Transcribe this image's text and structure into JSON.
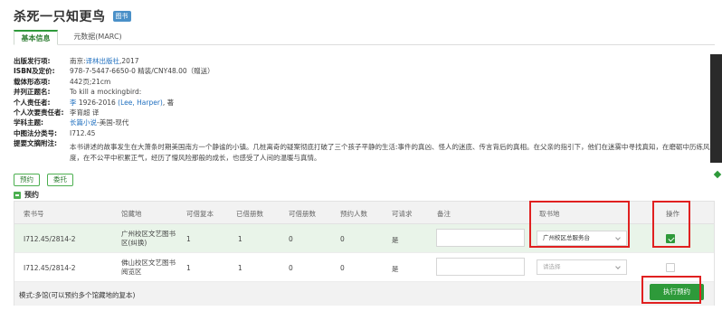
{
  "book": {
    "title": "杀死一只知更鸟",
    "badge": "图书"
  },
  "tabs": [
    {
      "label": "基本信息",
      "active": true
    },
    {
      "label": "元数据(MARC)",
      "active": false
    }
  ],
  "fields": [
    {
      "label": "出版发行项:",
      "pre": "南京:",
      "link": "译林出版社",
      "post": ",2017"
    },
    {
      "label": "ISBN及定价:",
      "pre": "978-7-5447-6650-0 精装/CNY48.00（赠送）",
      "link": "",
      "post": ""
    },
    {
      "label": "载体形态项:",
      "pre": "442页;21cm",
      "link": "",
      "post": ""
    },
    {
      "label": "并列正题名:",
      "pre": "To kill a mockingbird:",
      "link": "",
      "post": ""
    },
    {
      "label": "个人责任者:",
      "pre": "",
      "link": "李",
      "post": " 1926-2016 ",
      "link2": "(Lee, Harper)",
      "post2": ", 著"
    },
    {
      "label": "个人次要责任者:",
      "pre": "李育超 译",
      "link": "",
      "post": ""
    },
    {
      "label": "学科主题:",
      "pre": "",
      "link": "长篇小说",
      "post": "-美国-现代"
    },
    {
      "label": "中图法分类号:",
      "pre": "I712.45",
      "link": "",
      "post": ""
    },
    {
      "label": "提要文摘附注:",
      "pre": "",
      "link": "",
      "post": ""
    }
  ],
  "summary": "本书讲述的故事发生在大萧条时期美国南方一个静谧的小镇。几桩离奇的疑案彻底打破了三个孩子平静的生活:事件的真凶、怪人的迷底、传言背后的真相。在父亲的指引下，他们在迷雾中寻找真知，在磨砺中历练风度，在不公平中积累正气，经历了懵风险那般的成长，也感受了人间的温暖与真情。",
  "buttons": {
    "reserve": "预约",
    "delegate": "委托"
  },
  "reserve_section": {
    "title": "预约"
  },
  "table": {
    "headers": [
      "索书号",
      "馆藏地",
      "可借复本",
      "已借册数",
      "可借册数",
      "预约人数",
      "可请求",
      "备注",
      "取书地",
      "操作"
    ],
    "rows": [
      {
        "call_no": "I712.45/2814-2",
        "location": "广州校区文艺图书区(纠换)",
        "avail_copies": "1",
        "borrowed": "1",
        "loanable": "0",
        "reservations": "0",
        "requestable": "是",
        "remark": "",
        "pickup": "广州校区总服务台",
        "pickup_placeholder": false,
        "checked": true
      },
      {
        "call_no": "I712.45/2814-2",
        "location": "佛山校区文艺图书阅览区",
        "avail_copies": "1",
        "borrowed": "1",
        "loanable": "0",
        "reservations": "0",
        "requestable": "是",
        "remark": "",
        "pickup": "请选择",
        "pickup_placeholder": true,
        "checked": false
      }
    ],
    "mode_note": "模式:多馆(可以预约多个馆藏地的复本)",
    "execute_label": "执行预约"
  },
  "colors": {
    "accent": "#2e9a3a",
    "highlight": "#e02020",
    "link": "#1f6fbf"
  }
}
